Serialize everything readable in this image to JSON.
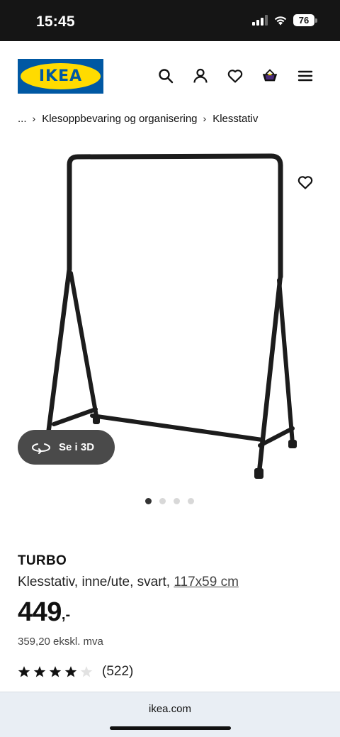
{
  "status_bar": {
    "time": "15:45",
    "battery": "76"
  },
  "header": {
    "logo_text": "IKEA",
    "icons": [
      "search-icon",
      "account-icon",
      "heart-icon",
      "basket-icon",
      "menu-icon"
    ]
  },
  "breadcrumb": {
    "ellipsis": "...",
    "items": [
      "Klesoppbevaring og organisering",
      "Klesstativ"
    ]
  },
  "gallery": {
    "view_3d_label": "Se i 3D",
    "dots_total": 4,
    "active_dot": 1
  },
  "product": {
    "brand": "TURBO",
    "description": "Klesstativ, inne/ute, svart, ",
    "dimensions": "117x59 cm",
    "price": "449",
    "price_suffix": ",-",
    "price_ex_vat": "359,20 ekskl. mva",
    "rating": 4,
    "rating_max": 5,
    "review_count": "(522)"
  },
  "browser": {
    "url": "ikea.com"
  },
  "colors": {
    "ikea_blue": "#0058a3",
    "ikea_yellow": "#ffdb00",
    "basket_purple": "#4b2c7a"
  }
}
